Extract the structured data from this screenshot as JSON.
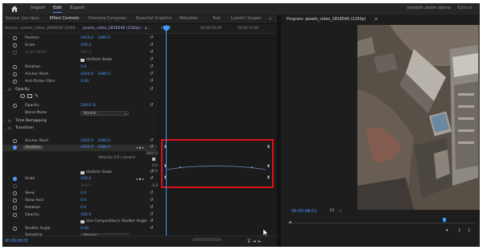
{
  "nav": {
    "items": [
      "Import",
      "Edit",
      "Export"
    ],
    "active": "Edit",
    "project_name": "smooth zoom demo",
    "project_status": "Edited"
  },
  "panel_tabs": [
    "Source: (no clips)",
    "Effect Controls",
    "Premiere Composer",
    "Essential Graphics",
    "Metadata",
    "Text",
    "Lumetri Scopes"
  ],
  "panel_tabs_active": "Effect Controls",
  "effect_controls": {
    "source": "Source · pexels_video_2818546 (2160...",
    "clip": "pexels_video_2818546 (2160p) - p...",
    "timeline_start": "00:00",
    "timeline_mid": "00:00:05:00",
    "timeline_end": "00:00:10:00",
    "rows": {
      "position_top": {
        "label": "Position",
        "v1": "1920.0",
        "v2": "1080.0"
      },
      "scale_top": {
        "label": "Scale",
        "v1": "100.0"
      },
      "scale_width_top": {
        "label": "Scale Width",
        "v1": "100.0"
      },
      "uniform_scale_top": {
        "label": "Uniform Scale"
      },
      "rotation_top": {
        "label": "Rotation",
        "v1": "0.0"
      },
      "anchor_top": {
        "label": "Anchor Point",
        "v1": "1920.0",
        "v2": "1080.0"
      },
      "antiflicker_top": {
        "label": "Anti-flicker Filter",
        "v1": "0.00"
      },
      "opacity_section": {
        "label": "Opacity"
      },
      "opacity": {
        "label": "Opacity",
        "v1": "100.0 %"
      },
      "blend_mode": {
        "label": "Blend Mode",
        "value": "Normal"
      },
      "time_remap": {
        "label": "Time Remapping"
      },
      "transform_section": {
        "label": "Transform"
      },
      "anchor": {
        "label": "Anchor Point",
        "v1": "1920.0",
        "v2": "1080.0"
      },
      "position": {
        "label": "Position",
        "v1": "1920.0",
        "v2": "1080.0"
      },
      "uniform_scale": {
        "label": "Uniform Scale"
      },
      "scale": {
        "label": "Scale",
        "v1": "100.0"
      },
      "scale_width": {
        "label": "",
        "v1": "100.0"
      },
      "skew": {
        "label": "Skew",
        "v1": "0.0"
      },
      "skew_axis": {
        "label": "Skew Axis",
        "v1": "0.0"
      },
      "rotation": {
        "label": "Rotation",
        "v1": "0.0"
      },
      "opacity2": {
        "label": "Opacity",
        "v1": "100.0"
      },
      "use_comp_shutter": {
        "label": "Use Composition's Shutter Angle"
      },
      "shutter_angle": {
        "label": "Shutter Angle",
        "v1": "0.00"
      },
      "sampling": {
        "label": "Sampling",
        "value": "Bilinear"
      }
    },
    "velocity_label": "Velocity: 0.0 / second",
    "graph_values": [
      "3840.0",
      "0.0",
      "0.0",
      "-0.0"
    ],
    "timecode": "00:00:08:01"
  },
  "program": {
    "tab": "Program: pexels_video_2818546 (2160p)",
    "timecode": "00:00:08:01",
    "fit": "Fit"
  },
  "colors": {
    "accent_blue": "#4f9cff",
    "playhead": "#3aa0ff",
    "highlight_box": "#e0101a"
  }
}
